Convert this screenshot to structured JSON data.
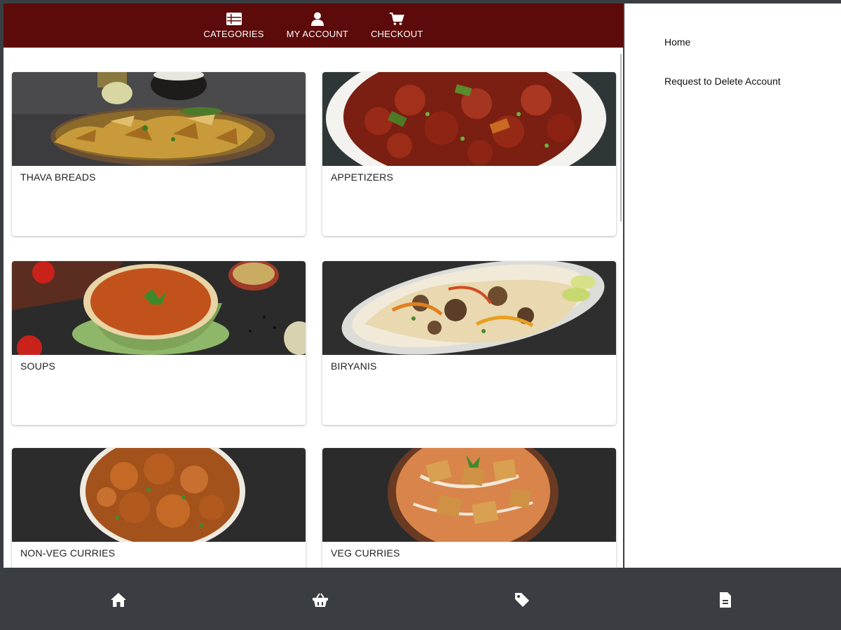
{
  "topnav": {
    "items": [
      {
        "icon": "list-icon",
        "label": "CATEGORIES"
      },
      {
        "icon": "user-icon",
        "label": "MY ACCOUNT"
      },
      {
        "icon": "cart-icon",
        "label": "CHECKOUT"
      }
    ],
    "bg_color": "#5c0a0a"
  },
  "categories": [
    {
      "title": "THAVA BREADS"
    },
    {
      "title": "APPETIZERS"
    },
    {
      "title": "SOUPS"
    },
    {
      "title": "BIRYANIS"
    },
    {
      "title": "NON-VEG CURRIES"
    },
    {
      "title": "VEG CURRIES"
    }
  ],
  "drawer": {
    "items": [
      {
        "label": "Home"
      },
      {
        "label": "Request to Delete Account"
      }
    ]
  },
  "bottombar": {
    "icons": [
      "home-icon",
      "basket-icon",
      "tag-icon",
      "document-icon"
    ],
    "bg_color": "#3a3e42"
  }
}
